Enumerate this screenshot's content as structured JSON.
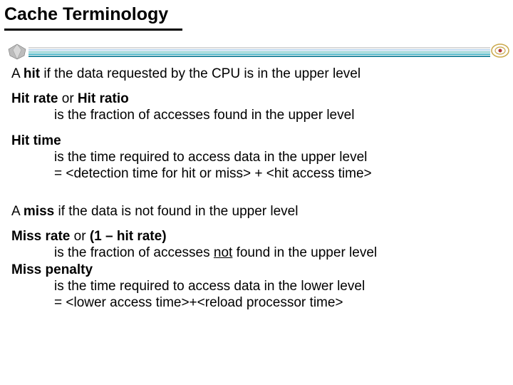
{
  "title": "Cache Terminology",
  "p1": {
    "prefix": "A ",
    "b": "hit",
    "rest": " if the data requested by the CPU is in the upper level"
  },
  "hr": {
    "b1": "Hit rate",
    "or": " or ",
    "b2": "Hit ratio",
    "line": "is the fraction of accesses found in the upper level"
  },
  "ht": {
    "b": "Hit time",
    "l1": "is the time required to access data in the upper level",
    "l2": "= <detection time for hit or miss> + <hit access time>"
  },
  "miss": {
    "prefix": "A ",
    "b": "miss",
    "rest": " if the data is not found in the upper level"
  },
  "mr": {
    "b": "Miss rate",
    "or": " or ",
    "alt": "(1 – hit rate)",
    "l_pre": "is the fraction of accesses ",
    "l_ul": "not",
    "l_post": " found in the upper level"
  },
  "mp": {
    "b": "Miss penalty",
    "l1": "is the time required to access data in the lower level",
    "l2": "= <lower access time>+<reload processor time>"
  }
}
